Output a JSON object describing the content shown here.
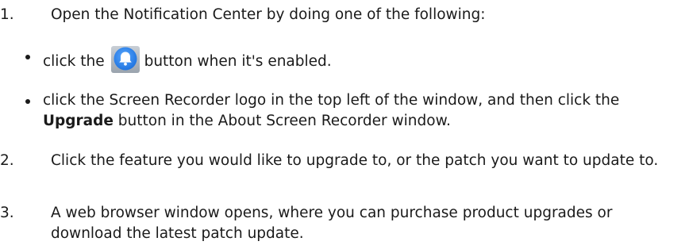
{
  "steps": [
    {
      "number": "1.",
      "text": "Open the Notification Center by doing one of the following:",
      "bullets": [
        {
          "before": "click the",
          "icon": "notification-bell-icon",
          "after": "button when it's enabled."
        },
        {
          "text_pre": "click the Screen Recorder logo in the top left of the window, and then click the ",
          "bold": "Upgrade",
          "text_post": " button in the About Screen Recorder window."
        }
      ]
    },
    {
      "number": "2.",
      "text": "Click the feature you would like to upgrade to, or the patch you want to update to."
    },
    {
      "number": "3.",
      "text": "A web browser window opens, where you can purchase product upgrades or download the latest patch update."
    }
  ],
  "colors": {
    "text": "#1a1a1a",
    "bell_button_blue": "#2f8bf0"
  }
}
